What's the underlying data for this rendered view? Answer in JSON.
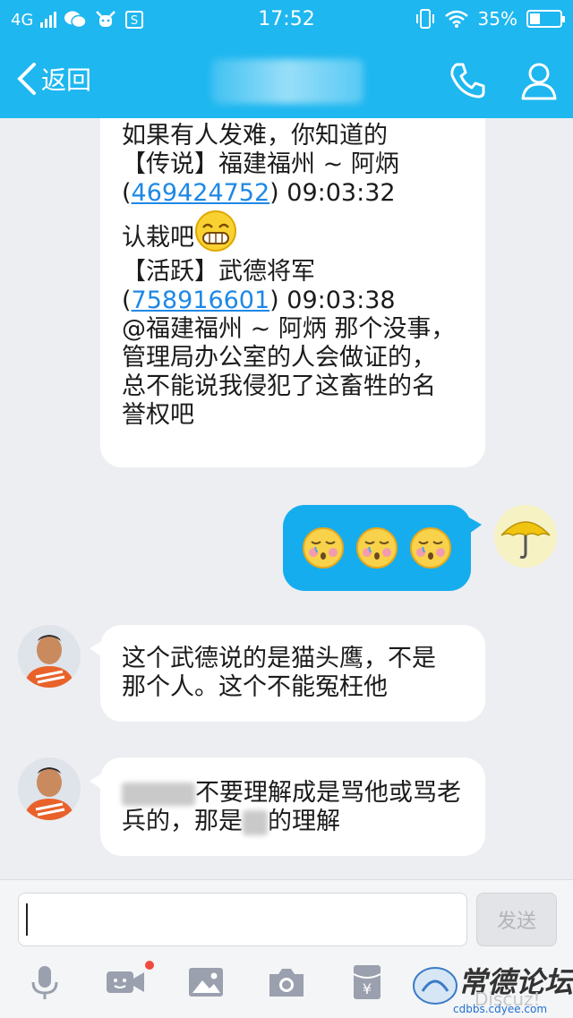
{
  "status_bar": {
    "network": "4G",
    "time": "17:52",
    "battery": "35%",
    "battery_level": 0.35
  },
  "header": {
    "back_label": "返回",
    "title": "",
    "call_icon": "phone-icon",
    "profile_icon": "person-icon"
  },
  "messages": {
    "m1": {
      "lines": [
        "如果有人发难，你知道的",
        "【传说】福建福州 ~ 阿炳"
      ],
      "meta_open": "(",
      "meta_link": "469424752",
      "meta_close": ")",
      "meta_time": "09:03:32",
      "text2": "认栽吧",
      "sender2": "【活跃】武德将军",
      "meta2_open": "(",
      "meta2_link": "758916601",
      "meta2_close": ")",
      "meta2_time": "09:03:38",
      "lines3": [
        "@福建福州 ~ 阿炳 那个没事，",
        "管理局办公室的人会做证的，",
        "总不能说我侵犯了这畜牲的名",
        "誉权吧"
      ]
    },
    "m3": {
      "lines": [
        "这个武德说的是猫头鹰，不是",
        "那个人。这个不能冤枉他"
      ]
    },
    "m4": {
      "line1": "不要理解成是骂他或骂老",
      "line2_a": "兵的，那是",
      "line2_b": "的理解"
    }
  },
  "input": {
    "placeholder": "",
    "send_label": "发送"
  },
  "toolbar": {
    "icons": [
      "microphone-icon",
      "video-call-icon",
      "image-icon",
      "camera-icon",
      "red-packet-icon"
    ]
  },
  "watermark": {
    "title": "常德论坛",
    "sub": "Discuz!",
    "url": "cdbbs.cdyee.com"
  },
  "colors": {
    "accent": "#1eb7f0",
    "outgoing_bubble": "#15adee",
    "link": "#1e88e5",
    "background": "#eceef2"
  }
}
